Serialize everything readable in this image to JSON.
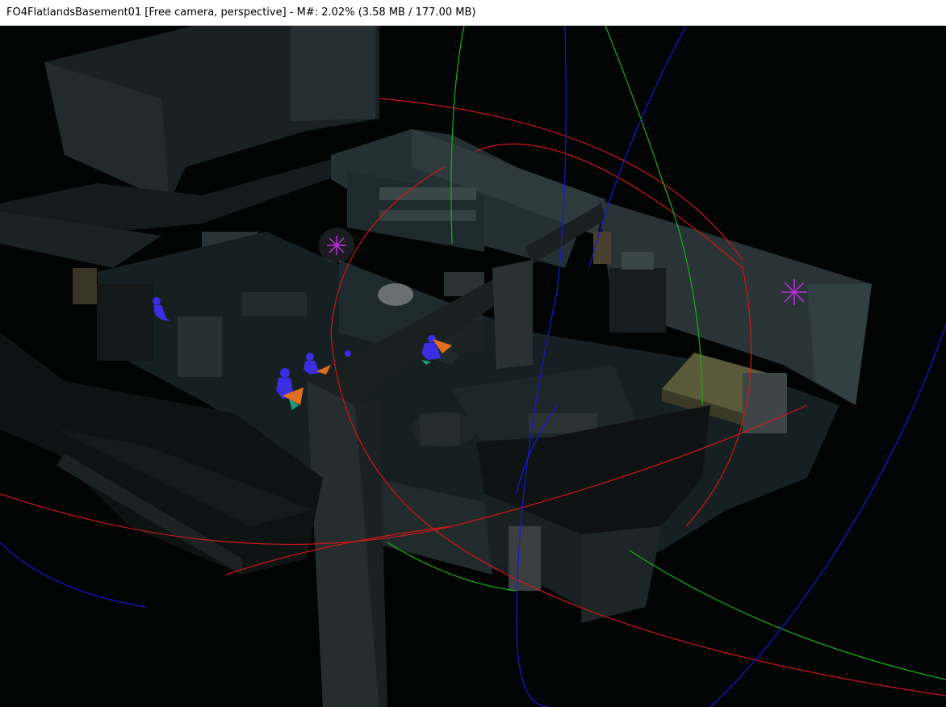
{
  "window": {
    "title": "FO4FlatlandsBasement01 [Free camera, perspective] - M#: 2.02% (3.58 MB / 177.00 MB)"
  },
  "viewport": {
    "scene": "FO4FlatlandsBasement01",
    "camera_mode": "Free camera",
    "projection": "perspective",
    "memory_percent": "2.02%",
    "memory_used": "3.58 MB",
    "memory_total": "177.00 MB",
    "colors": {
      "background": "#020404",
      "gizmo_x": "#d01818",
      "gizmo_y": "#18b018",
      "gizmo_z": "#1818d8",
      "light_marker": "#c030e0",
      "npc_marker": "#3a2ee0",
      "furniture_marker": "#e07020"
    }
  }
}
